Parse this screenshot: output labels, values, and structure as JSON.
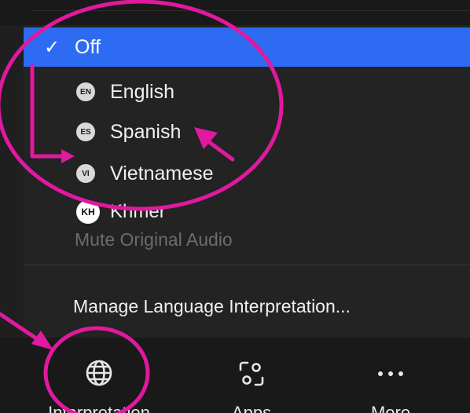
{
  "menu": {
    "items": [
      {
        "label": "Off",
        "checked": true
      },
      {
        "label": "English",
        "badge": "EN"
      },
      {
        "label": "Spanish",
        "badge": "ES"
      },
      {
        "label": "Vietnamese",
        "badge": "VI"
      },
      {
        "label": "Khmer",
        "badge": "KH"
      }
    ],
    "mute_label": "Mute Original Audio",
    "manage_label": "Manage Language Interpretation..."
  },
  "toolbar": {
    "items": [
      {
        "label": "Interpretation",
        "icon": "globe-icon"
      },
      {
        "label": "Apps",
        "icon": "apps-icon"
      },
      {
        "label": "More",
        "icon": "more-icon"
      }
    ]
  },
  "colors": {
    "selected": "#2d6cf2",
    "annotation": "#e0199f",
    "menu_bg": "#232323",
    "toolbar_bg": "#191919"
  }
}
